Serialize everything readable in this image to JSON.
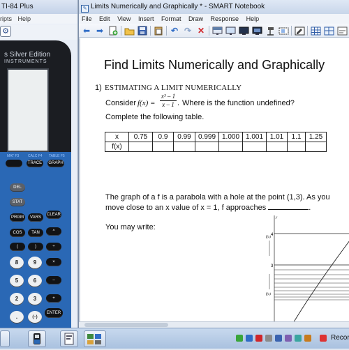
{
  "ti_window": {
    "title": "TI-84 Plus",
    "menu": [
      "ripts",
      "Help"
    ],
    "brand_line1": "s Silver Edition",
    "brand_line2": "INSTRUMENTS",
    "function_labels": [
      "MAT F3",
      "CALC F4",
      "TABLE F5"
    ],
    "keys": {
      "trace": "TRACE",
      "graph": "GRAPH",
      "del": "DEL",
      "stat": "STAT",
      "vars": "VARS",
      "clear": "CLEAR",
      "prgm": "PRGM",
      "cos": "COS",
      "tan": "TAN",
      "n8": "8",
      "n9": "9",
      "n5": "5",
      "n6": "6",
      "n2": "2",
      "n3": "3",
      "dot": ".",
      "neg": "(–)",
      "enter": "ENTER"
    }
  },
  "notebook": {
    "title": "Limits Numerically and Graphically * - SMART Notebook",
    "menu": [
      "File",
      "Edit",
      "View",
      "Insert",
      "Format",
      "Draw",
      "Response",
      "Help"
    ],
    "toolbar_icons": [
      "back-arrow-icon",
      "forward-arrow-icon",
      "add-page-icon",
      "open-folder-icon",
      "save-icon",
      "paste-icon",
      "undo-icon",
      "redo-icon",
      "delete-icon",
      "screen-shade-icon",
      "display-icon",
      "monitor-icon",
      "monitor-alt-icon",
      "document-camera-icon",
      "capture-icon",
      "table-icon",
      "more-icon"
    ]
  },
  "document": {
    "title": "Find Limits Numerically and Graphically",
    "section_number": "1)",
    "section_title": "ESTIMATING A LIMIT NUMERICALLY",
    "consider_label": "Consider",
    "formula_prefix": "f(x) =",
    "formula_numerator": "x³ – 1",
    "formula_denominator": "x – 1",
    "formula_suffix": ".",
    "question": "Where is the function undefined?",
    "instruction": "Complete the following table.",
    "table": {
      "row_x_label": "x",
      "row_fx_label": "f(x)",
      "x_values": [
        "0.75",
        "0.9",
        "0.99",
        "0.999",
        "1.000",
        "1.001",
        "1.01",
        "1.1",
        "1.25"
      ]
    },
    "graph_sentence_1": "The graph of a f is a parabola with a hole at the point (1,3).  As you",
    "graph_sentence_2_start": "move close to an x value of x = 1, f approaches",
    "graph_sentence_2_end": ".",
    "you_may_write": "You may write:",
    "mini_graph": {
      "y_label_top": "y",
      "fx_label_upper": "f(x)",
      "fx_label_lower": "f(x)",
      "tick_4": "4",
      "tick_3": "3"
    }
  },
  "taskbar": {
    "tray_text": "Recor"
  },
  "colors": {
    "calc_blue": "#2a68b5",
    "calc_black": "#1b1d22",
    "window_title": "#c8d6ea"
  }
}
